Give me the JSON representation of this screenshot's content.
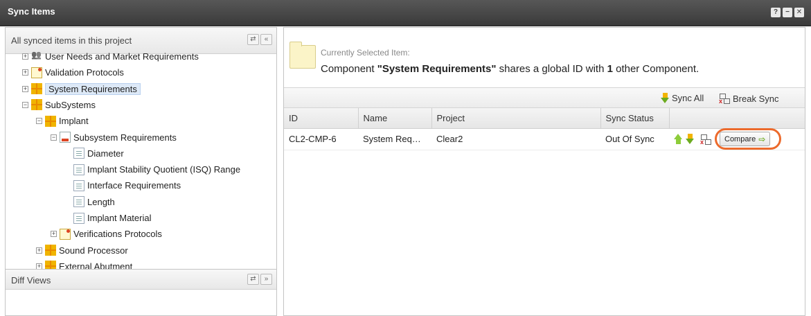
{
  "window": {
    "title": "Sync Items",
    "buttons": [
      "?",
      "−",
      "✕"
    ]
  },
  "left_panel": {
    "header": "All synced items in this project",
    "tree": [
      {
        "label": "User Needs and Market Requirements",
        "icon": "users-icon",
        "indent": 0,
        "expander": "+"
      },
      {
        "label": "Validation Protocols",
        "icon": "validation-icon",
        "indent": 0,
        "expander": "+"
      },
      {
        "label": "System Requirements",
        "icon": "component-icon",
        "indent": 0,
        "expander": "+",
        "selected": true
      },
      {
        "label": "SubSystems",
        "icon": "component-icon",
        "indent": 0,
        "expander": "−"
      },
      {
        "label": "Implant",
        "icon": "component-icon",
        "indent": 1,
        "expander": "−"
      },
      {
        "label": "Subsystem Requirements",
        "icon": "requirements-doc-icon",
        "indent": 2,
        "expander": "−"
      },
      {
        "label": "Diameter",
        "icon": "document-icon",
        "indent": 3,
        "expander": ""
      },
      {
        "label": "Implant Stability Quotient (ISQ) Range",
        "icon": "document-icon",
        "indent": 3,
        "expander": ""
      },
      {
        "label": "Interface Requirements",
        "icon": "document-icon",
        "indent": 3,
        "expander": ""
      },
      {
        "label": "Length",
        "icon": "document-icon",
        "indent": 3,
        "expander": ""
      },
      {
        "label": "Implant Material",
        "icon": "document-icon",
        "indent": 3,
        "expander": ""
      },
      {
        "label": "Verifications Protocols",
        "icon": "validation-icon",
        "indent": 2,
        "expander": "+"
      },
      {
        "label": "Sound Processor",
        "icon": "component-icon",
        "indent": 1,
        "expander": "+"
      },
      {
        "label": "External Abutment",
        "icon": "component-icon",
        "indent": 1,
        "expander": "+"
      }
    ]
  },
  "diff_panel": {
    "header": "Diff Views"
  },
  "right_panel": {
    "currently_selected_label": "Currently Selected Item:",
    "message": {
      "prefix": "Component ",
      "name": "\"System Requirements\"",
      "middle": " shares a global ID with ",
      "count": "1",
      "suffix": " other Component."
    },
    "toolbar": {
      "sync_all": "Sync All",
      "break_sync": "Break Sync"
    },
    "table": {
      "columns": [
        "ID",
        "Name",
        "Project",
        "Sync Status",
        ""
      ],
      "rows": [
        {
          "id": "CL2-CMP-6",
          "name": "System Req…",
          "project": "Clear2",
          "sync_status": "Out Of Sync",
          "compare_label": "Compare"
        }
      ]
    }
  }
}
